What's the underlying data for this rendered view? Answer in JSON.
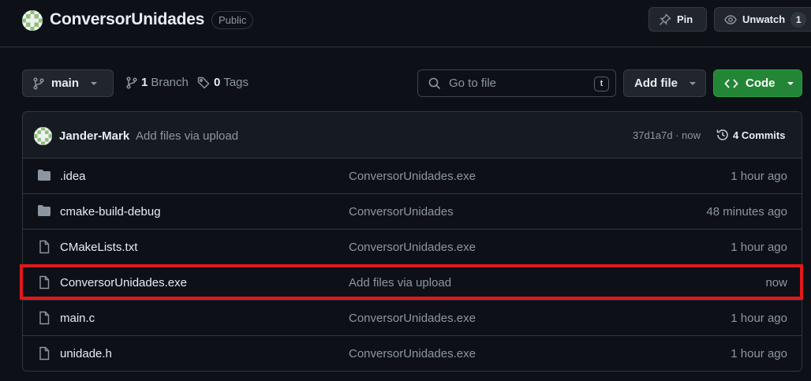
{
  "repo": {
    "name": "ConversorUnidades",
    "visibility": "Public",
    "avatar_icon": "identicon-avatar"
  },
  "header_actions": {
    "pin_label": "Pin",
    "watch_label": "Unwatch",
    "watch_count": "1"
  },
  "toolbar": {
    "branch_label": "main",
    "branches_count": "1",
    "branches_label": "Branch",
    "tags_count": "0",
    "tags_label": "Tags",
    "search_placeholder": "Go to file",
    "search_shortcut": "t",
    "add_file_label": "Add file",
    "code_label": "Code"
  },
  "latest_commit": {
    "author": "Jander-Mark",
    "message": "Add files via upload",
    "hash_time": "37d1a7d · now",
    "commits_count": "4",
    "commits_label": "Commits"
  },
  "files": [
    {
      "type": "folder",
      "name": ".idea",
      "commit": "ConversorUnidades.exe",
      "age": "1 hour ago"
    },
    {
      "type": "folder",
      "name": "cmake-build-debug",
      "commit": "ConversorUnidades",
      "age": "48 minutes ago"
    },
    {
      "type": "file",
      "name": "CMakeLists.txt",
      "commit": "ConversorUnidades.exe",
      "age": "1 hour ago"
    },
    {
      "type": "file",
      "name": "ConversorUnidades.exe",
      "commit": "Add files via upload",
      "age": "now"
    },
    {
      "type": "file",
      "name": "main.c",
      "commit": "ConversorUnidades.exe",
      "age": "1 hour ago"
    },
    {
      "type": "file",
      "name": "unidade.h",
      "commit": "ConversorUnidades.exe",
      "age": "1 hour ago"
    }
  ],
  "highlight": {
    "target_file": "ConversorUnidades.exe",
    "color": "#e0191c"
  },
  "colors": {
    "background": "#0d1117",
    "code_button": "#238636",
    "muted_text": "#8d96a0"
  }
}
